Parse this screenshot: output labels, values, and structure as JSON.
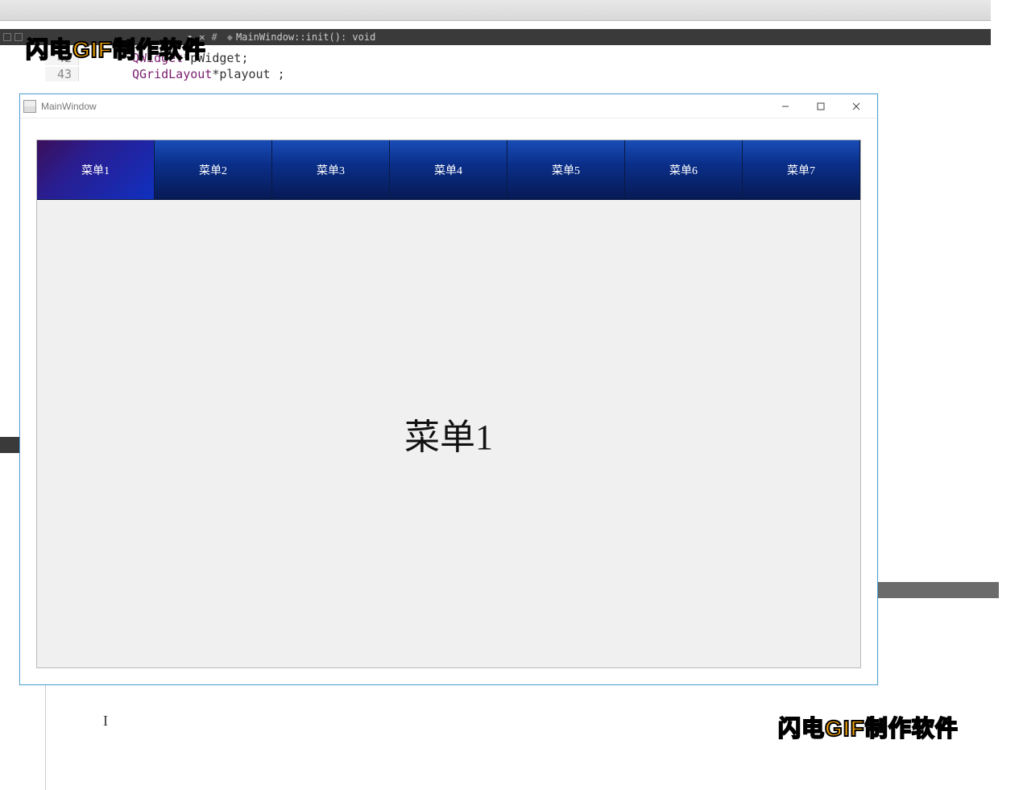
{
  "ide": {
    "breadcrumb": "MainWindow::init(): void",
    "dropdown_arrow": "▾",
    "close": "✕",
    "hash": "#",
    "code": {
      "lines": [
        {
          "num": "42",
          "t1": "QWidget ",
          "t2": "*pWidget;"
        },
        {
          "num": "43",
          "t1": "QGridLayout ",
          "t2": "*playout ;"
        }
      ]
    }
  },
  "watermark": {
    "part1": "闪电",
    "part2": "GIF",
    "part3": "制作软件"
  },
  "app": {
    "title": "MainWindow",
    "tabs": [
      "菜单1",
      "菜单2",
      "菜单3",
      "菜单4",
      "菜单5",
      "菜单6",
      "菜单7"
    ],
    "content_label": "菜单1"
  }
}
